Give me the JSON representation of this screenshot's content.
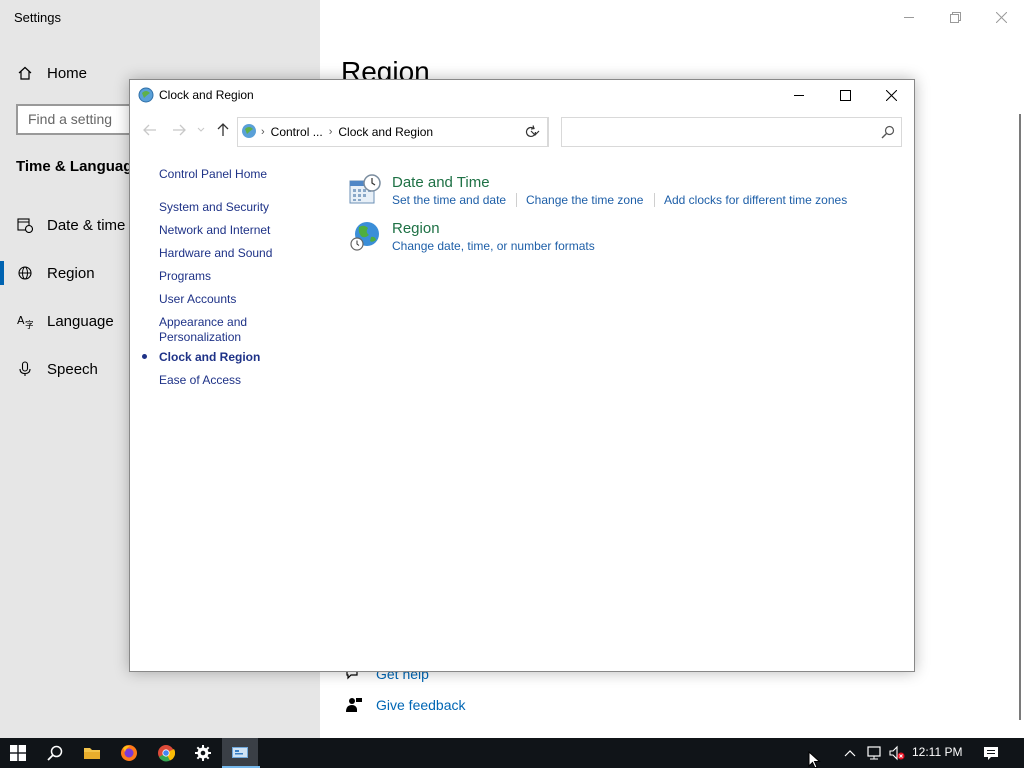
{
  "settings": {
    "title": "Settings",
    "search_placeholder": "Find a setting",
    "home_label": "Home",
    "section_title": "Time & Language",
    "nav": [
      {
        "label": "Date & time",
        "icon": "calendar-clock-icon"
      },
      {
        "label": "Region",
        "icon": "globe-icon",
        "selected": true
      },
      {
        "label": "Language",
        "icon": "language-icon"
      },
      {
        "label": "Speech",
        "icon": "microphone-icon"
      }
    ],
    "page_title": "Region",
    "bottom_links": [
      {
        "label": "Get help",
        "icon": "help-chat-icon"
      },
      {
        "label": "Give feedback",
        "icon": "feedback-icon"
      }
    ]
  },
  "control_panel": {
    "window_title": "Clock and Region",
    "breadcrumb": [
      "Control ...",
      "Clock and Region"
    ],
    "search_placeholder": "",
    "left_pane": {
      "home": "Control Panel Home",
      "items": [
        "System and Security",
        "Network and Internet",
        "Hardware and Sound",
        "Programs",
        "User Accounts",
        "Appearance and Personalization",
        "Clock and Region",
        "Ease of Access"
      ],
      "current": "Clock and Region"
    },
    "categories": [
      {
        "title": "Date and Time",
        "icon": "date-time-icon",
        "links": [
          "Set the time and date",
          "Change the time zone",
          "Add clocks for different time zones"
        ]
      },
      {
        "title": "Region",
        "icon": "region-globe-icon",
        "links": [
          "Change date, time, or number formats"
        ]
      }
    ]
  },
  "taskbar": {
    "clock": "12:11 PM",
    "pinned": [
      "start-icon",
      "search-icon",
      "file-explorer-icon",
      "firefox-icon",
      "chrome-icon",
      "settings-gear-icon",
      "control-panel-icon"
    ]
  },
  "colors": {
    "link_blue": "#1e5fa8",
    "category_green": "#1e7145",
    "accent": "#0063b1",
    "taskbar": "#101418"
  }
}
